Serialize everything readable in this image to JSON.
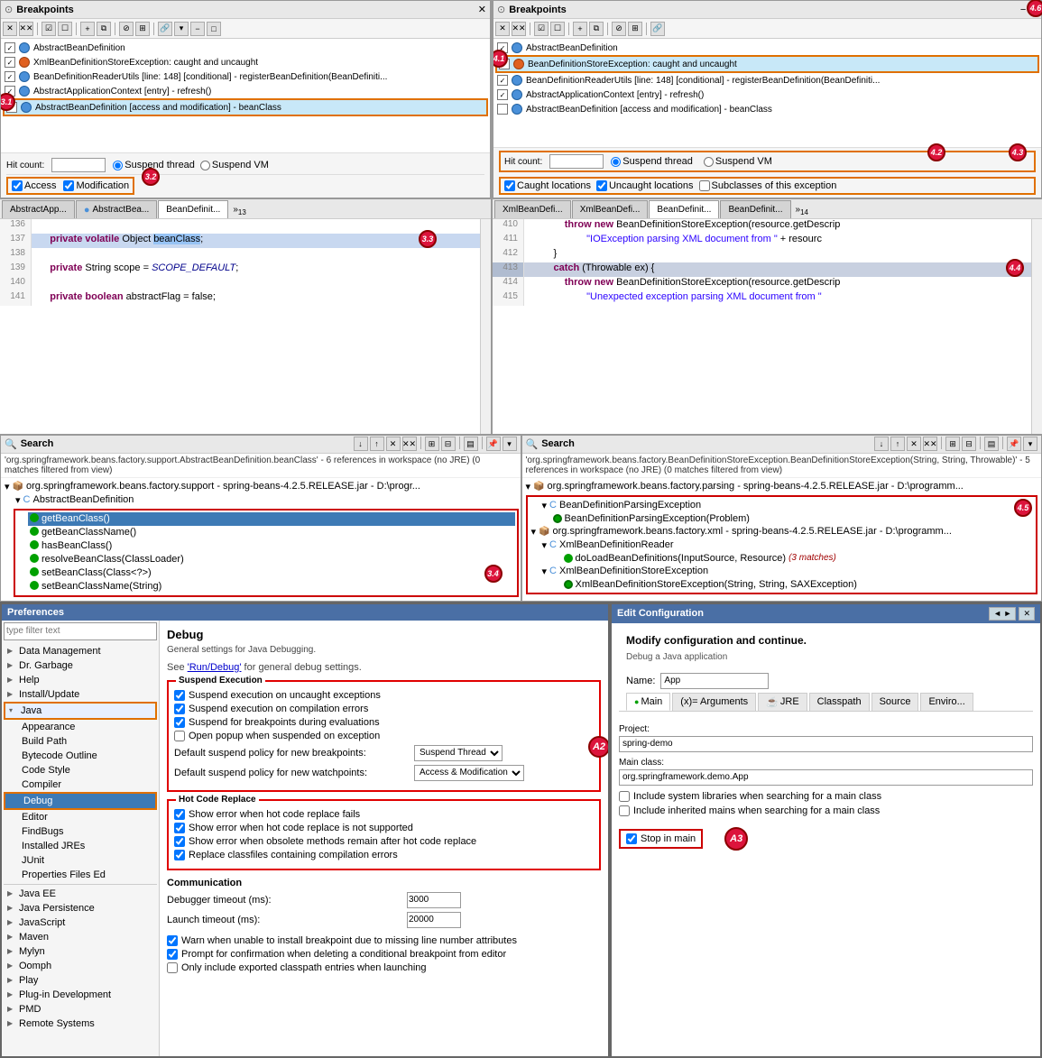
{
  "left_breakpoints": {
    "title": "Breakpoints",
    "items": [
      {
        "checked": true,
        "type": "bean",
        "text": "AbstractBeanDefinition"
      },
      {
        "checked": true,
        "type": "exception",
        "text": "XmlBeanDefinitionStoreException: caught and uncaught"
      },
      {
        "checked": true,
        "type": "bean",
        "text": "BeanDefinitionReaderUtils [line: 148] [conditional] - registerBeanDefinition(BeanDefiniti..."
      },
      {
        "checked": true,
        "type": "bean",
        "text": "AbstractApplicationContext [entry] - refresh()"
      },
      {
        "checked": true,
        "type": "bean",
        "text": "AbstractBeanDefinition [access and modification] - beanClass",
        "selected": true
      }
    ],
    "hit_count_label": "Hit count:",
    "suspend_thread_label": "Suspend thread",
    "suspend_vm_label": "Suspend VM",
    "access_label": "Access",
    "modification_label": "Modification",
    "badge_31": "3.1",
    "badge_32": "3.2"
  },
  "right_breakpoints": {
    "title": "Breakpoints",
    "items": [
      {
        "checked": true,
        "type": "bean",
        "text": "AbstractBeanDefinition"
      },
      {
        "checked": true,
        "type": "exception",
        "text": "BeanDefinitionStoreException: caught and uncaught",
        "selected": true
      },
      {
        "checked": true,
        "type": "bean",
        "text": "BeanDefinitionReaderUtils [line: 148] [conditional] - registerBeanDefinition(BeanDefiniti..."
      },
      {
        "checked": true,
        "type": "bean",
        "text": "AbstractApplicationContext [entry] - refresh()"
      },
      {
        "checked": false,
        "type": "bean",
        "text": "AbstractBeanDefinition [access and modification] - beanClass"
      }
    ],
    "hit_count_label": "Hit count:",
    "suspend_thread_label": "Suspend thread",
    "suspend_vm_label": "Suspend VM",
    "caught_label": "Caught locations",
    "uncaught_label": "Uncaught locations",
    "subclasses_label": "Subclasses of this exception",
    "badge_41": "4.1",
    "badge_42": "4.2",
    "badge_43": "4.3",
    "badge_46": "4.6"
  },
  "left_editor": {
    "tabs": [
      "AbstractApp...",
      "AbstractBea...",
      "BeanDefinit..."
    ],
    "tab_more": "»",
    "tab_count": "13",
    "lines": [
      {
        "num": "136",
        "content": ""
      },
      {
        "num": "137",
        "content": "    private volatile Object beanClass;",
        "highlighted": true
      },
      {
        "num": "138",
        "content": ""
      },
      {
        "num": "139",
        "content": "    private String scope = SCOPE_DEFAULT;"
      },
      {
        "num": "140",
        "content": ""
      },
      {
        "num": "141",
        "content": "    private boolean abstractFlag = false;"
      }
    ],
    "badge_33": "3.3"
  },
  "right_editor": {
    "tabs": [
      "XmlBeanDefi...",
      "XmlBeanDefi...",
      "BeanDefinit...",
      "BeanDefinit..."
    ],
    "tab_more": "»",
    "tab_count": "14",
    "lines": [
      {
        "num": "410",
        "content": "            throw new BeanDefinitionStoreException(resource.getDescrip"
      },
      {
        "num": "411",
        "content": "                    \"IOException parsing XML document from \" + resourc"
      },
      {
        "num": "412",
        "content": "        }"
      },
      {
        "num": "413",
        "content": "        catch (Throwable ex) {",
        "highlighted": true
      },
      {
        "num": "414",
        "content": "            throw new BeanDefinitionStoreException(resource.getDescrip"
      },
      {
        "num": "415",
        "content": "                    \"Unexpected exception parsing XML document from \" "
      }
    ],
    "badge_44": "4.4"
  },
  "left_search": {
    "title": "Search",
    "description": "'org.springframework.beans.factory.support.AbstractBeanDefinition.beanClass' - 6 references in workspace (no JRE) (0 matches filtered from view)",
    "tree": {
      "root": "org.springframework.beans.factory.support - spring-beans-4.2.5.RELEASE.jar - D:\\progr...",
      "children": [
        {
          "label": "AbstractBeanDefinition",
          "items": [
            "getBeanClass()",
            "getBeanClassName()",
            "hasBeanClass()",
            "resolveBeanClass(ClassLoader)",
            "setBeanClass(Class<?>)",
            "setBeanClassName(String)"
          ]
        }
      ]
    },
    "badge_34": "3.4"
  },
  "right_search": {
    "title": "Search",
    "description": "'org.springframework.beans.factory.BeanDefinitionStoreException.BeanDefinitionStoreException(String, String, Throwable)' - 5 references in workspace (no JRE) (0 matches filtered from view)",
    "tree": {
      "pkg1": "org.springframework.beans.factory.parsing - spring-beans-4.2.5.RELEASE.jar - D:\\programm...",
      "pkg1_children": [
        {
          "label": "BeanDefinitionParsingException"
        },
        {
          "label": "BeanDefinitionParsingException(Problem)"
        }
      ],
      "pkg2": "org.springframework.beans.factory.xml - spring-beans-4.2.5.RELEASE.jar - D:\\programm...",
      "pkg2_children": [
        {
          "label": "XmlBeanDefinitionReader",
          "children": [
            {
              "label": "doLoadBeanDefinitions(InputSource, Resource)",
              "matches": "(3 matches)"
            }
          ]
        },
        {
          "label": "XmlBeanDefinitionStoreException",
          "children": [
            {
              "label": "XmlBeanDefinitionStoreException(String, String, SAXException)"
            }
          ]
        }
      ]
    },
    "badge_45": "4.5"
  },
  "preferences": {
    "title": "Preferences",
    "filter_placeholder": "type filter text",
    "sidebar_items": [
      {
        "label": "Data Management",
        "expanded": false,
        "indent": 0
      },
      {
        "label": "Dr. Garbage",
        "expanded": false,
        "indent": 0
      },
      {
        "label": "Help",
        "expanded": false,
        "indent": 0
      },
      {
        "label": "Install/Update",
        "expanded": false,
        "indent": 0
      },
      {
        "label": "Java",
        "expanded": true,
        "indent": 0,
        "selected_border": true
      },
      {
        "label": "Appearance",
        "indent": 1
      },
      {
        "label": "Build Path",
        "indent": 1
      },
      {
        "label": "Bytecode Outline",
        "indent": 1
      },
      {
        "label": "Code Style",
        "indent": 1
      },
      {
        "label": "Compiler",
        "indent": 1
      },
      {
        "label": "Debug",
        "indent": 1,
        "selected": true,
        "border": true
      },
      {
        "label": "Editor",
        "indent": 1
      },
      {
        "label": "FindBugs",
        "indent": 1
      },
      {
        "label": "Installed JREs",
        "indent": 1
      },
      {
        "label": "JUnit",
        "indent": 1
      },
      {
        "label": "Properties Files Ed",
        "indent": 1
      },
      {
        "label": "Java EE",
        "indent": 0
      },
      {
        "label": "Java Persistence",
        "indent": 0
      },
      {
        "label": "JavaScript",
        "indent": 0
      },
      {
        "label": "Maven",
        "indent": 0
      },
      {
        "label": "Mylyn",
        "indent": 0
      },
      {
        "label": "Oomph",
        "indent": 0
      },
      {
        "label": "Play",
        "indent": 0
      },
      {
        "label": "Plug-in Development",
        "indent": 0
      },
      {
        "label": "PMD",
        "indent": 0
      },
      {
        "label": "Remote Systems",
        "indent": 0
      }
    ],
    "content": {
      "title": "Debug",
      "description": "General settings for Java Debugging.",
      "link_text": "'Run/Debug'",
      "link_suffix": " for general debug settings.",
      "see_text": "See ",
      "suspend_execution_group": "Suspend Execution",
      "checkboxes": [
        {
          "label": "Suspend execution on uncaught exceptions",
          "checked": true
        },
        {
          "label": "Suspend execution on compilation errors",
          "checked": true
        },
        {
          "label": "Suspend for breakpoints during evaluations",
          "checked": true
        },
        {
          "label": "Open popup when suspended on exception",
          "checked": false
        }
      ],
      "default_suspend_label": "Default suspend policy for new breakpoints:",
      "default_suspend_value": "Suspend Thread",
      "default_watchpoint_label": "Default suspend policy for new watchpoints:",
      "default_watchpoint_value": "Access & Modification",
      "hot_code_group": "Hot Code Replace",
      "hot_code_checkboxes": [
        {
          "label": "Show error when hot code replace fails",
          "checked": true
        },
        {
          "label": "Show error when hot code replace is not supported",
          "checked": true
        },
        {
          "label": "Show error when obsolete methods remain after hot code replace",
          "checked": true
        },
        {
          "label": "Replace classfiles containing compilation errors",
          "checked": true
        }
      ],
      "communication_label": "Communication",
      "debugger_timeout_label": "Debugger timeout (ms):",
      "debugger_timeout_value": "3000",
      "launch_timeout_label": "Launch timeout (ms):",
      "launch_timeout_value": "20000",
      "bottom_checkboxes": [
        {
          "label": "Warn when unable to install breakpoint due to missing line number attributes",
          "checked": true
        },
        {
          "label": "Prompt for confirmation when deleting a conditional breakpoint from editor",
          "checked": true
        },
        {
          "label": "Only include exported classpath entries when launching",
          "checked": false
        }
      ]
    },
    "badge_a2": "A2"
  },
  "edit_config": {
    "title": "Edit Configuration",
    "modify_text": "Modify configuration and continue.",
    "debug_text": "Debug a Java application",
    "name_label": "Name:",
    "name_value": "App",
    "tabs": [
      "Main",
      "Arguments",
      "JRE",
      "Classpath",
      "Source",
      "Enviro..."
    ],
    "tab_icons": [
      "green-dot",
      "args",
      "jre",
      "classpath",
      "source",
      "env"
    ],
    "project_label": "Project:",
    "project_value": "spring-demo",
    "main_class_label": "Main class:",
    "main_class_value": "org.springframework.demo.App",
    "include_system_label": "Include system libraries when searching for a main class",
    "include_inherited_label": "Include inherited mains when searching for a main class",
    "stop_in_main_label": "Stop in main",
    "stop_in_main_checked": true,
    "badge_a3": "A3"
  }
}
